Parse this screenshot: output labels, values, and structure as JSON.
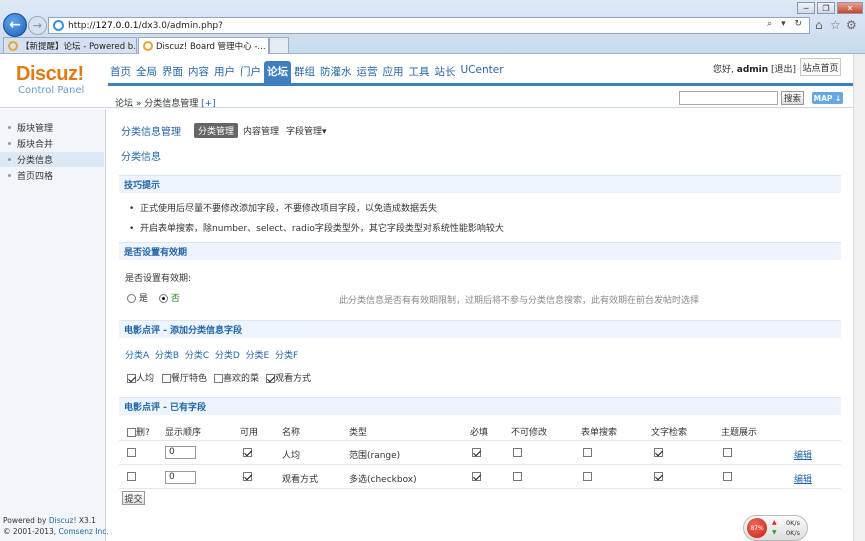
{
  "browser": {
    "url_prefix": "http://",
    "url_host": "127.0.0.1",
    "url_path": "/dx3.0/admin.php?",
    "addr_tools": "⌕ ▾ ↻",
    "win_min": "─",
    "win_max": "❐",
    "win_close": "✕",
    "tabs": [
      {
        "label": "【新提醒】论坛 - Powered b...",
        "active": false
      },
      {
        "label": "Discuz! Board 管理中心 -...",
        "active": true,
        "close": "×"
      }
    ]
  },
  "header": {
    "logo": "Discuz!",
    "logo_sub": "Control Panel",
    "nav": [
      "首页",
      "全局",
      "界面",
      "内容",
      "用户",
      "门户",
      "论坛",
      "群组",
      "防灌水",
      "运营",
      "应用",
      "工具",
      "站长",
      "UCenter"
    ],
    "nav_active": "论坛",
    "greeting": "您好,",
    "username": "admin",
    "logout": "[退出]",
    "site_home": "站点首页",
    "breadcrumb": "论坛 » 分类信息管理",
    "breadcrumb_add": "[+]",
    "search_button": "搜索",
    "map_button": "MAP ↓"
  },
  "sidebar": {
    "items": [
      "版块管理",
      "版块合并",
      "分类信息",
      "首页四格"
    ],
    "active_index": 2,
    "powered_by": "Powered by",
    "powered_brand": "Discuz!",
    "powered_version": "X3.1",
    "copyright": "© 2001-2013,",
    "company": "Comsenz Inc."
  },
  "main": {
    "title": "分类信息管理",
    "tabs": [
      "分类管理",
      "内容管理",
      "字段管理▾"
    ],
    "subtitle": "分类信息",
    "tips_header": "技巧提示",
    "tips": [
      "正式使用后尽量不要修改添加字段，不要修改项目字段，以免造成数据丢失",
      "开启表单搜索，除number、select、radio字段类型外，其它字段类型对系统性能影响较大"
    ],
    "validity_header": "是否设置有效期",
    "validity_label": "是否设置有效期:",
    "validity_yes": "是",
    "validity_no": "否",
    "validity_selected": "否",
    "validity_hint": "此分类信息是否有有效期限制，过期后将不参与分类信息搜索，此有效期在前台发帖时选择",
    "add_fields_header": "电影点评 - 添加分类信息字段",
    "categories": [
      "分类A",
      "分类B",
      "分类C",
      "分类D",
      "分类E",
      "分类F"
    ],
    "field_options": [
      {
        "label": "人均",
        "checked": true
      },
      {
        "label": "餐厅特色",
        "checked": false
      },
      {
        "label": "喜欢的菜",
        "checked": false
      },
      {
        "label": "观看方式",
        "checked": true
      }
    ],
    "existing_header": "电影点评 - 已有字段",
    "columns": [
      "删?",
      "显示顺序",
      "可用",
      "名称",
      "类型",
      "必填",
      "不可修改",
      "表单搜索",
      "文字检索",
      "主题展示"
    ],
    "rows": [
      {
        "order": "0",
        "enabled": true,
        "name": "人均",
        "type": "范围(range)",
        "required": true,
        "readonly": false,
        "form_search": false,
        "text_search": true,
        "show": false,
        "edit": "编辑"
      },
      {
        "order": "0",
        "enabled": true,
        "name": "观看方式",
        "type": "多选(checkbox)",
        "required": true,
        "readonly": false,
        "form_search": false,
        "text_search": true,
        "show": false,
        "edit": "编辑"
      }
    ],
    "submit": "提交"
  },
  "netmon": {
    "percent": "87%",
    "up": "0K/s",
    "down": "0K/s"
  }
}
